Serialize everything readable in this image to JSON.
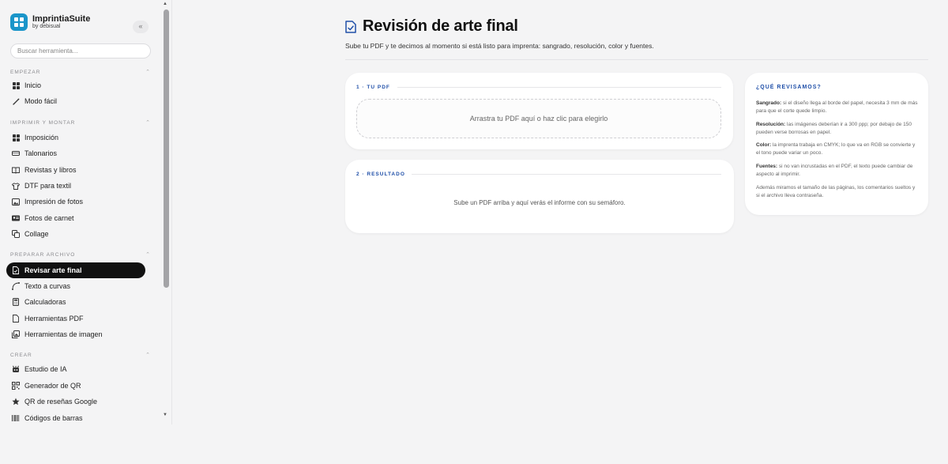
{
  "app": {
    "name": "ImprintiaSuite",
    "by": "by debisual",
    "collapse_icon": "collapse-icon"
  },
  "search": {
    "placeholder": "Buscar herramienta..."
  },
  "sidebar": {
    "sections": [
      {
        "title": "EMPEZAR",
        "items": [
          {
            "label": "Inicio",
            "icon": "grid-icon"
          },
          {
            "label": "Modo fácil",
            "icon": "wand-icon"
          }
        ]
      },
      {
        "title": "IMPRIMIR Y MONTAR",
        "items": [
          {
            "label": "Imposición",
            "icon": "grid-icon"
          },
          {
            "label": "Talonarios",
            "icon": "ticket-icon"
          },
          {
            "label": "Revistas y libros",
            "icon": "book-icon"
          },
          {
            "label": "DTF para textil",
            "icon": "shirt-icon"
          },
          {
            "label": "Impresión de fotos",
            "icon": "image-icon"
          },
          {
            "label": "Fotos de carnet",
            "icon": "id-card-icon"
          },
          {
            "label": "Collage",
            "icon": "collage-icon"
          }
        ]
      },
      {
        "title": "PREPARAR ARCHIVO",
        "items": [
          {
            "label": "Revisar arte final",
            "icon": "file-check-icon",
            "active": true
          },
          {
            "label": "Texto a curvas",
            "icon": "curve-icon"
          },
          {
            "label": "Calculadoras",
            "icon": "calculator-icon"
          },
          {
            "label": "Herramientas PDF",
            "icon": "file-icon"
          },
          {
            "label": "Herramientas de imagen",
            "icon": "images-icon"
          }
        ]
      },
      {
        "title": "CREAR",
        "items": [
          {
            "label": "Estudio de IA",
            "icon": "robot-icon"
          },
          {
            "label": "Generador de QR",
            "icon": "qr-icon"
          },
          {
            "label": "QR de reseñas Google",
            "icon": "star-icon"
          },
          {
            "label": "Códigos de barras",
            "icon": "barcode-icon"
          }
        ]
      }
    ]
  },
  "main": {
    "title": "Revisión de arte final",
    "subtitle": "Sube tu PDF y te decimos al momento si está listo para imprenta: sangrado, resolución, color y fuentes.",
    "upload_card": {
      "label": "1 · TU PDF",
      "dropzone_text": "Arrastra tu PDF aquí o haz clic para elegirlo"
    },
    "result_card": {
      "label": "2 · RESULTADO",
      "message": "Sube un PDF arriba y aquí verás el informe con su semáforo."
    },
    "info_card": {
      "heading": "¿QUÉ REVISAMOS?",
      "items": [
        {
          "term": "Sangrado:",
          "text": " si el diseño llega al borde del papel, necesita 3 mm de más para que el corte quede limpio."
        },
        {
          "term": "Resolución:",
          "text": " las imágenes deberían ir a 300 ppp; por debajo de 150 pueden verse borrosas en papel."
        },
        {
          "term": "Color:",
          "text": " la imprenta trabaja en CMYK; lo que va en RGB se convierte y el tono puede variar un poco."
        },
        {
          "term": "Fuentes:",
          "text": " si no van incrustadas en el PDF, el texto puede cambiar de aspecto al imprimir."
        },
        {
          "term": "",
          "text": "Además miramos el tamaño de las páginas, los comentarios sueltos y si el archivo lleva contraseña."
        }
      ]
    }
  },
  "colors": {
    "accent": "#1f4fa8",
    "logo": "#1a95c9",
    "active_bg": "#111111"
  }
}
